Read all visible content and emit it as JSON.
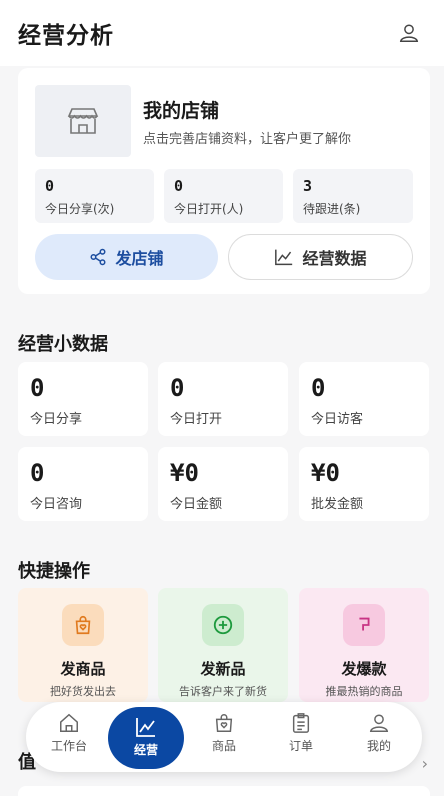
{
  "header": {
    "title": "经营分析",
    "user_icon": "user-icon"
  },
  "store": {
    "name": "我的店铺",
    "desc": "点击完善店铺资料，让客户更了解你",
    "stats": [
      {
        "value": "0",
        "label": "今日分享(次)"
      },
      {
        "value": "0",
        "label": "今日打开(人)"
      },
      {
        "value": "3",
        "label": "待跟进(条)"
      }
    ],
    "share_button": "发店铺",
    "data_button": "经营数据"
  },
  "mini_data": {
    "title": "经营小数据",
    "tiles": [
      {
        "value": "0",
        "label": "今日分享"
      },
      {
        "value": "0",
        "label": "今日打开"
      },
      {
        "value": "0",
        "label": "今日访客"
      },
      {
        "value": "0",
        "label": "今日咨询"
      },
      {
        "value": "¥0",
        "label": "今日金额"
      },
      {
        "value": "¥0",
        "label": "批发金额"
      }
    ]
  },
  "quick": {
    "title": "快捷操作",
    "items": [
      {
        "title": "发商品",
        "sub": "把好货发出去",
        "icon": "shopping-bag-icon"
      },
      {
        "title": "发新品",
        "sub": "告诉客户来了新货",
        "icon": "plus-circle-icon"
      },
      {
        "title": "发爆款",
        "sub": "推最热销的商品",
        "icon": "flag-icon"
      }
    ]
  },
  "peek": {
    "title": "值",
    "arrow": "›"
  },
  "tabbar": {
    "items": [
      {
        "label": "工作台",
        "icon": "home-icon"
      },
      {
        "label": "经营",
        "icon": "chart-icon"
      },
      {
        "label": "商品",
        "icon": "bag-icon"
      },
      {
        "label": "订单",
        "icon": "clipboard-icon"
      },
      {
        "label": "我的",
        "icon": "person-icon"
      }
    ]
  },
  "colors": {
    "accent": "#0b48a3",
    "share_bg": "#dfeafb",
    "quick_orange": "#fdf1e6",
    "quick_green": "#eaf6ea",
    "quick_pink": "#fbe8f2"
  }
}
